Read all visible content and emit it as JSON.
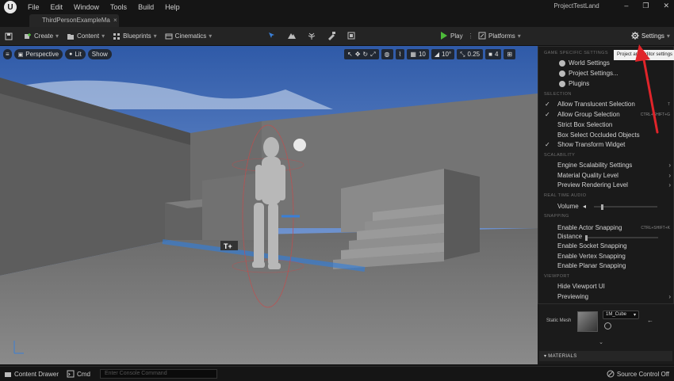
{
  "titlebar": {
    "menu": [
      "File",
      "Edit",
      "Window",
      "Tools",
      "Build",
      "Help"
    ],
    "project_name": "ProjectTestLand",
    "minimize": "–",
    "maximize": "❐",
    "close": "✕"
  },
  "tab": {
    "label": "ThirdPersonExampleMa"
  },
  "toolbar": {
    "create": "Create",
    "content": "Content",
    "blueprints": "Blueprints",
    "cinematics": "Cinematics",
    "play": "Play",
    "platforms": "Platforms",
    "settings": "Settings"
  },
  "viewport": {
    "perspective": "Perspective",
    "lit": "Lit",
    "show": "Show",
    "grid_snap": "10",
    "rot_snap": "10°",
    "scale_snap": "0.25",
    "cam_speed": "4"
  },
  "settings_menu": {
    "sections": {
      "game_specific": "GAME SPECIFIC SETTINGS",
      "selection": "SELECTION",
      "scalability": "SCALABILITY",
      "realtime_audio": "REAL TIME AUDIO",
      "snapping": "SNAPPING",
      "viewport": "VIEWPORT"
    },
    "world_settings": "World Settings",
    "project_settings": "Project Settings...",
    "plugins": "Plugins",
    "allow_translucent": "Allow Translucent Selection",
    "allow_translucent_key": "T",
    "allow_group": "Allow Group Selection",
    "allow_group_key": "CTRL+SHIFT+G",
    "strict_box": "Strict Box Selection",
    "box_occluded": "Box Select Occluded Objects",
    "show_transform": "Show Transform Widget",
    "engine_scalability": "Engine Scalability Settings",
    "material_quality": "Material Quality Level",
    "preview_rendering": "Preview Rendering Level",
    "volume": "Volume",
    "volume_level": 0.12,
    "enable_actor_snapping": "Enable Actor Snapping",
    "enable_actor_snapping_key": "CTRL+SHIFT+K",
    "distance": "Distance",
    "distance_level": 0.0,
    "enable_socket": "Enable Socket Snapping",
    "enable_vertex": "Enable Vertex Snapping",
    "enable_planar": "Enable Planar Snapping",
    "hide_viewport_ui": "Hide Viewport UI",
    "previewing": "Previewing"
  },
  "tooltip": "Project and Editor settings",
  "details": {
    "static_mesh_label": "Static Mesh",
    "mesh_value": "1M_Cube",
    "materials_label": "MATERIALS"
  },
  "bottombar": {
    "content_drawer": "Content Drawer",
    "cmd": "Cmd",
    "console_placeholder": "Enter Console Command",
    "source_control": "Source Control Off"
  },
  "colors": {
    "play_green": "#4dbb3a",
    "arrow_red": "#e0242a",
    "accent_blue": "#3a7fd6"
  }
}
